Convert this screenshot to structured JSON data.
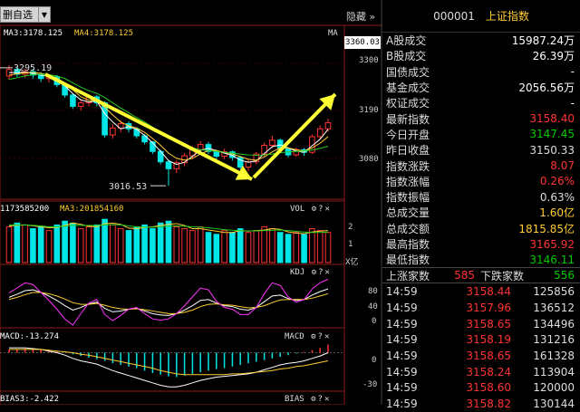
{
  "toolbar": {
    "label": "删自选",
    "dropdown_icon": "triangle-down-icon",
    "hide_label": "隐藏"
  },
  "price_panel": {
    "ma_legend": [
      {
        "text": "MA3:3178.125",
        "color": "#ffffff"
      },
      {
        "text": "MA4:3178.125",
        "color": "#ffcc33"
      }
    ],
    "indicator": "MA",
    "current_price": "3360.03",
    "y_ticks": [
      "3300",
      "3190",
      "3080"
    ],
    "high_label": "3295.19",
    "low_label": "3016.53"
  },
  "vol_panel": {
    "legend": [
      "1173585200",
      "MA3:201854160"
    ],
    "name": "VOL",
    "y_ticks": [
      "2",
      "1"
    ],
    "unit": "X亿"
  },
  "kdj_panel": {
    "name": "KDJ",
    "y_ticks": [
      "80",
      "40",
      "0"
    ]
  },
  "macd_panel": {
    "legend": "MACD:-13.274",
    "name": "MACD",
    "y_ticks": [
      "0",
      "-30"
    ]
  },
  "bias_panel": {
    "legend": "BIAS3:-2.422",
    "name": "BIAS"
  },
  "quote": {
    "code": "000001",
    "name": "上证指数",
    "rows": [
      {
        "label": "A股成交",
        "value": "15987.24万",
        "color": "#ffffff"
      },
      {
        "label": "B股成交",
        "value": "26.39万",
        "color": "#ffffff"
      },
      {
        "label": "国债成交",
        "value": "-",
        "color": "#ffffff"
      },
      {
        "label": "基金成交",
        "value": "2056.56万",
        "color": "#ffffff"
      },
      {
        "label": "权证成交",
        "value": "-",
        "color": "#ffffff"
      },
      {
        "label": "最新指数",
        "value": "3158.40",
        "color": "#ff3333"
      },
      {
        "label": "今日开盘",
        "value": "3147.45",
        "color": "#00cc00"
      },
      {
        "label": "昨日收盘",
        "value": "3150.33",
        "color": "#dddddd"
      },
      {
        "label": "指数涨跌",
        "value": "8.07",
        "color": "#ff3333"
      },
      {
        "label": "指数涨幅",
        "value": "0.26%",
        "color": "#ff3333"
      },
      {
        "label": "指数振幅",
        "value": "0.63%",
        "color": "#dddddd"
      },
      {
        "label": "总成交量",
        "value": "1.60亿",
        "color": "#ffcc33"
      },
      {
        "label": "总成交额",
        "value": "1815.85亿",
        "color": "#ffcc33"
      },
      {
        "label": "最高指数",
        "value": "3165.92",
        "color": "#ff3333"
      },
      {
        "label": "最低指数",
        "value": "3146.11",
        "color": "#00cc00"
      }
    ],
    "breadth": {
      "up_label": "上涨家数",
      "up_value": "585",
      "down_label": "下跌家数",
      "down_value": "556"
    },
    "ticks": [
      {
        "time": "14:59",
        "price": "3158.44",
        "vol": "125856"
      },
      {
        "time": "14:59",
        "price": "3157.96",
        "vol": "136512"
      },
      {
        "time": "14:59",
        "price": "3158.65",
        "vol": "134496"
      },
      {
        "time": "14:59",
        "price": "3158.19",
        "vol": "131216"
      },
      {
        "time": "14:59",
        "price": "3158.65",
        "vol": "161328"
      },
      {
        "time": "14:59",
        "price": "3158.24",
        "vol": "113904"
      },
      {
        "time": "14:59",
        "price": "3158.60",
        "vol": "120000"
      },
      {
        "time": "14:59",
        "price": "3158.82",
        "vol": "130144"
      }
    ]
  },
  "colors": {
    "up": "#ff3333",
    "down": "#00e5e5",
    "ma_white": "#ffffff",
    "ma_yellow": "#ffcc33",
    "ma_green": "#22cc22",
    "ma_magenta": "#ff33ff",
    "arrow": "#ffff33"
  },
  "chart_data": [
    {
      "type": "candlestick",
      "title": "",
      "ylabel": "",
      "ylim": [
        2990,
        3370
      ],
      "y_ticks": [
        3300,
        3190,
        3080
      ],
      "annotations": [
        "3295.19",
        "3016.53"
      ],
      "candles": [
        {
          "o": 3270,
          "c": 3285,
          "h": 3295,
          "l": 3262
        },
        {
          "o": 3285,
          "c": 3274,
          "h": 3290,
          "l": 3268
        },
        {
          "o": 3274,
          "c": 3280,
          "h": 3287,
          "l": 3266
        },
        {
          "o": 3280,
          "c": 3272,
          "h": 3286,
          "l": 3264
        },
        {
          "o": 3272,
          "c": 3264,
          "h": 3279,
          "l": 3256
        },
        {
          "o": 3264,
          "c": 3268,
          "h": 3274,
          "l": 3255
        },
        {
          "o": 3268,
          "c": 3250,
          "h": 3272,
          "l": 3244
        },
        {
          "o": 3250,
          "c": 3226,
          "h": 3253,
          "l": 3220
        },
        {
          "o": 3226,
          "c": 3200,
          "h": 3230,
          "l": 3194
        },
        {
          "o": 3200,
          "c": 3208,
          "h": 3215,
          "l": 3190
        },
        {
          "o": 3208,
          "c": 3222,
          "h": 3228,
          "l": 3200
        },
        {
          "o": 3222,
          "c": 3208,
          "h": 3226,
          "l": 3200
        },
        {
          "o": 3208,
          "c": 3134,
          "h": 3212,
          "l": 3128
        },
        {
          "o": 3134,
          "c": 3150,
          "h": 3158,
          "l": 3126
        },
        {
          "o": 3150,
          "c": 3160,
          "h": 3168,
          "l": 3140
        },
        {
          "o": 3160,
          "c": 3148,
          "h": 3166,
          "l": 3140
        },
        {
          "o": 3148,
          "c": 3132,
          "h": 3152,
          "l": 3126
        },
        {
          "o": 3132,
          "c": 3118,
          "h": 3136,
          "l": 3112
        },
        {
          "o": 3118,
          "c": 3096,
          "h": 3120,
          "l": 3090
        },
        {
          "o": 3096,
          "c": 3072,
          "h": 3100,
          "l": 3066
        },
        {
          "o": 3072,
          "c": 3056,
          "h": 3076,
          "l": 3017
        },
        {
          "o": 3056,
          "c": 3070,
          "h": 3076,
          "l": 3046
        },
        {
          "o": 3070,
          "c": 3086,
          "h": 3092,
          "l": 3062
        },
        {
          "o": 3086,
          "c": 3100,
          "h": 3108,
          "l": 3080
        },
        {
          "o": 3100,
          "c": 3112,
          "h": 3120,
          "l": 3094
        },
        {
          "o": 3112,
          "c": 3096,
          "h": 3118,
          "l": 3090
        },
        {
          "o": 3096,
          "c": 3085,
          "h": 3100,
          "l": 3078
        },
        {
          "o": 3085,
          "c": 3095,
          "h": 3102,
          "l": 3078
        },
        {
          "o": 3095,
          "c": 3082,
          "h": 3098,
          "l": 3075
        },
        {
          "o": 3082,
          "c": 3060,
          "h": 3086,
          "l": 3054
        },
        {
          "o": 3060,
          "c": 3072,
          "h": 3080,
          "l": 3050
        },
        {
          "o": 3072,
          "c": 3090,
          "h": 3095,
          "l": 3066
        },
        {
          "o": 3090,
          "c": 3110,
          "h": 3116,
          "l": 3084
        },
        {
          "o": 3110,
          "c": 3122,
          "h": 3132,
          "l": 3104
        },
        {
          "o": 3122,
          "c": 3102,
          "h": 3126,
          "l": 3094
        },
        {
          "o": 3102,
          "c": 3088,
          "h": 3106,
          "l": 3082
        },
        {
          "o": 3088,
          "c": 3100,
          "h": 3105,
          "l": 3084
        },
        {
          "o": 3100,
          "c": 3094,
          "h": 3104,
          "l": 3086
        },
        {
          "o": 3094,
          "c": 3130,
          "h": 3135,
          "l": 3090
        },
        {
          "o": 3130,
          "c": 3148,
          "h": 3156,
          "l": 3124
        },
        {
          "o": 3148,
          "c": 3162,
          "h": 3172,
          "l": 3142
        }
      ],
      "ma_series": [
        {
          "color": "#ffffff",
          "values": [
            3278,
            3278,
            3279,
            3276,
            3272,
            3269,
            3261,
            3247,
            3229,
            3215,
            3210,
            3212,
            3183,
            3164,
            3148,
            3153,
            3147,
            3133,
            3116,
            3096,
            3075,
            3066,
            3071,
            3085,
            3099,
            3103,
            3098,
            3092,
            3087,
            3076,
            3071,
            3074,
            3091,
            3107,
            3111,
            3104,
            3097,
            3094,
            3109,
            3124,
            3147
          ]
        },
        {
          "color": "#ffcc33",
          "values": [
            3272,
            3275,
            3277,
            3278,
            3276,
            3272,
            3265,
            3254,
            3238,
            3222,
            3214,
            3212,
            3198,
            3180,
            3164,
            3155,
            3150,
            3140,
            3126,
            3110,
            3092,
            3080,
            3076,
            3080,
            3090,
            3098,
            3098,
            3094,
            3090,
            3084,
            3078,
            3076,
            3083,
            3095,
            3104,
            3104,
            3100,
            3097,
            3104,
            3115,
            3130
          ]
        },
        {
          "color": "#22cc22",
          "values": [
            3262,
            3266,
            3270,
            3273,
            3274,
            3273,
            3270,
            3264,
            3254,
            3244,
            3236,
            3230,
            3220,
            3208,
            3196,
            3185,
            3174,
            3164,
            3152,
            3140,
            3128,
            3118,
            3110,
            3104,
            3100,
            3098,
            3096,
            3094,
            3092,
            3090,
            3088,
            3087,
            3088,
            3090,
            3093,
            3095,
            3096,
            3097,
            3099,
            3103,
            3108
          ]
        }
      ]
    },
    {
      "type": "bar",
      "title": "VOL",
      "ylim": [
        0,
        2.5
      ],
      "y_ticks": [
        2,
        1
      ],
      "values": [
        1.9,
        2.1,
        2.0,
        1.8,
        1.9,
        1.7,
        2.0,
        2.2,
        2.1,
        1.8,
        1.9,
        2.0,
        2.3,
        2.0,
        1.8,
        1.7,
        1.9,
        2.0,
        1.8,
        2.1,
        2.2,
        1.9,
        1.8,
        1.7,
        1.9,
        1.6,
        1.5,
        1.7,
        1.6,
        1.8,
        1.6,
        1.7,
        1.9,
        1.8,
        1.6,
        1.5,
        1.6,
        1.5,
        1.8,
        1.7,
        1.6
      ],
      "up_down": [
        "u",
        "d",
        "u",
        "d",
        "d",
        "u",
        "d",
        "d",
        "d",
        "u",
        "u",
        "d",
        "d",
        "u",
        "u",
        "d",
        "d",
        "d",
        "d",
        "d",
        "d",
        "u",
        "u",
        "u",
        "u",
        "d",
        "d",
        "u",
        "d",
        "d",
        "u",
        "u",
        "u",
        "u",
        "d",
        "d",
        "u",
        "d",
        "u",
        "u",
        "u"
      ],
      "series": [
        {
          "color": "#ffcc33",
          "values": [
            1.95,
            1.98,
            2.0,
            1.95,
            1.9,
            1.85,
            1.87,
            1.97,
            2.1,
            2.03,
            1.93,
            1.9,
            2.07,
            2.1,
            2.03,
            1.83,
            1.8,
            1.87,
            1.9,
            1.97,
            2.03,
            2.07,
            1.97,
            1.8,
            1.8,
            1.73,
            1.67,
            1.6,
            1.6,
            1.7,
            1.67,
            1.7,
            1.73,
            1.8,
            1.77,
            1.63,
            1.57,
            1.53,
            1.63,
            1.67,
            1.7
          ]
        },
        {
          "color": "#22cc22",
          "values": [
            2.0,
            2.0,
            2.0,
            1.98,
            1.95,
            1.9,
            1.9,
            1.93,
            1.98,
            1.98,
            1.97,
            1.97,
            2.0,
            2.02,
            2.0,
            1.95,
            1.9,
            1.88,
            1.88,
            1.9,
            1.93,
            1.95,
            1.93,
            1.9,
            1.88,
            1.85,
            1.8,
            1.75,
            1.72,
            1.7,
            1.68,
            1.68,
            1.7,
            1.72,
            1.73,
            1.7,
            1.66,
            1.62,
            1.6,
            1.6,
            1.62
          ]
        }
      ]
    },
    {
      "type": "line",
      "title": "KDJ",
      "ylim": [
        -10,
        105
      ],
      "y_ticks": [
        80,
        40,
        0
      ],
      "series": [
        {
          "name": "K",
          "color": "#ffffff",
          "values": [
            55,
            62,
            70,
            72,
            66,
            58,
            48,
            36,
            26,
            32,
            40,
            44,
            30,
            22,
            24,
            28,
            30,
            24,
            18,
            15,
            14,
            18,
            26,
            36,
            48,
            50,
            42,
            36,
            34,
            28,
            26,
            32,
            45,
            58,
            60,
            52,
            48,
            50,
            60,
            68,
            74
          ]
        },
        {
          "name": "D",
          "color": "#ffcc33",
          "values": [
            50,
            55,
            61,
            66,
            66,
            63,
            58,
            51,
            43,
            39,
            39,
            41,
            37,
            32,
            29,
            28,
            29,
            27,
            24,
            21,
            18,
            18,
            21,
            26,
            34,
            39,
            40,
            38,
            37,
            34,
            31,
            32,
            36,
            43,
            49,
            50,
            50,
            50,
            53,
            58,
            63
          ]
        },
        {
          "name": "J",
          "color": "#ff33ff",
          "values": [
            65,
            76,
            88,
            84,
            66,
            48,
            28,
            6,
            -8,
            18,
            42,
            50,
            16,
            2,
            14,
            28,
            32,
            18,
            6,
            3,
            6,
            18,
            36,
            56,
            76,
            72,
            46,
            32,
            28,
            16,
            16,
            32,
            63,
            88,
            82,
            56,
            44,
            50,
            74,
            88,
            96
          ]
        }
      ]
    },
    {
      "type": "bar",
      "title": "MACD",
      "ylim": [
        -45,
        15
      ],
      "y_ticks": [
        0,
        -30
      ],
      "values": [
        4,
        4,
        5,
        5,
        4,
        3,
        2,
        0,
        -2,
        -4,
        -6,
        -8,
        -10,
        -13,
        -15,
        -17,
        -19,
        -22,
        -25,
        -27,
        -29,
        -30,
        -28,
        -26,
        -24,
        -22,
        -20,
        -19,
        -17,
        -15,
        -13,
        -11,
        -9,
        -7,
        -5,
        -3,
        -1,
        1,
        3,
        6,
        10
      ],
      "series": [
        {
          "name": "DIF",
          "color": "#ffffff",
          "values": [
            6,
            6,
            6,
            5,
            4,
            2,
            0,
            -3,
            -7,
            -10,
            -12,
            -14,
            -18,
            -22,
            -25,
            -28,
            -31,
            -34,
            -37,
            -40,
            -42,
            -42,
            -40,
            -37,
            -34,
            -32,
            -30,
            -29,
            -28,
            -27,
            -26,
            -24,
            -21,
            -18,
            -15,
            -13,
            -12,
            -10,
            -7,
            -4,
            0
          ]
        },
        {
          "name": "DEA",
          "color": "#ffcc33",
          "values": [
            4,
            4,
            4,
            4,
            4,
            3,
            2,
            1,
            0,
            -2,
            -3,
            -5,
            -7,
            -9,
            -11,
            -13,
            -15,
            -17,
            -19,
            -22,
            -24,
            -26,
            -27,
            -27,
            -27,
            -27,
            -27,
            -27,
            -26,
            -26,
            -25,
            -24,
            -23,
            -22,
            -20,
            -19,
            -17,
            -16,
            -14,
            -12,
            -10
          ]
        }
      ]
    }
  ]
}
